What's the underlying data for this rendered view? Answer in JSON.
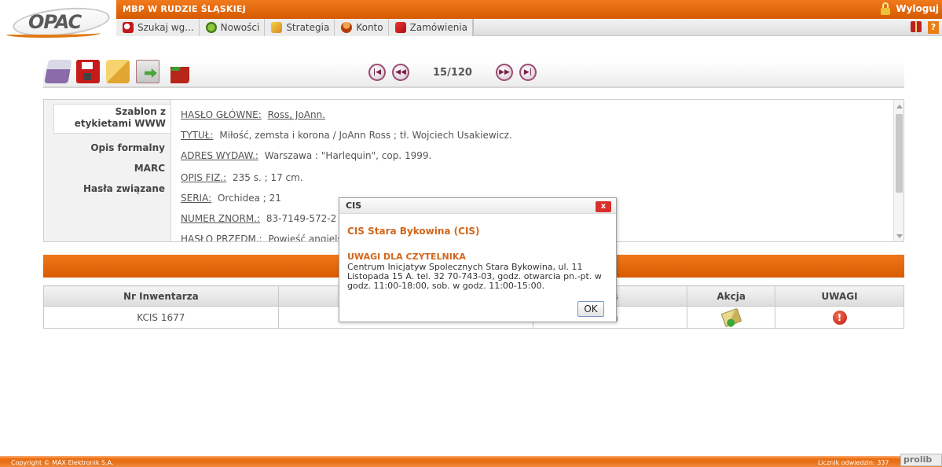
{
  "header": {
    "logo_text": "OPAC",
    "library_name": "MBP W RUDZIE ŚLĄSKIEJ",
    "logout_label": "Wyloguj"
  },
  "menu": {
    "items": [
      {
        "label": "Szukaj wg...",
        "icon": "search-icon"
      },
      {
        "label": "Nowości",
        "icon": "new-items-icon"
      },
      {
        "label": "Strategia",
        "icon": "strategy-icon"
      },
      {
        "label": "Konto",
        "icon": "account-icon"
      },
      {
        "label": "Zamówienia",
        "icon": "orders-icon"
      }
    ],
    "help_label": "?"
  },
  "pager": {
    "counter": "15/120"
  },
  "record": {
    "tabs": [
      {
        "label": "Szablon z etykietami WWW"
      },
      {
        "label": "Opis formalny"
      },
      {
        "label": "MARC"
      },
      {
        "label": "Hasła związane"
      }
    ],
    "fields": [
      {
        "label": "HASŁO GŁÓWNE:",
        "value": "Ross, JoAnn."
      },
      {
        "label": "TYTUŁ:",
        "value": "Miłość, zemsta i korona / JoAnn Ross ; tł. Wojciech Usakiewicz."
      },
      {
        "label": "ADRES WYDAW.:",
        "value": "Warszawa : \"Harlequin\", cop. 1999."
      },
      {
        "label": "OPIS FIZ.:",
        "value": "235 s. ; 17 cm."
      },
      {
        "label": "SERIA:",
        "value": "Orchidea ; 21"
      },
      {
        "label": "NUMER ZNORM.:",
        "value": "83-7149-572-2"
      },
      {
        "label": "HASŁO PRZEDM.:",
        "value": "Powieść angielska 2"
      }
    ]
  },
  "holdings": {
    "headers": [
      "Nr Inwentarza",
      "",
      "s",
      "Akcja",
      "UWAGI"
    ],
    "rows": [
      {
        "inventory": "KCIS 1677",
        "col2": "",
        "col3": "a"
      }
    ]
  },
  "dialog": {
    "title": "CIS",
    "close_label": "x",
    "heading": "CIS Stara Bykowina (CIS)",
    "subheading": "UWAGI DLA CZYTELNIKA",
    "text": "Centrum Inicjatyw Spolecznych Stara Bykowina, ul. 11 Listopada 15 A. tel. 32 70-743-03, godz. otwarcia pn.-pt. w godz. 11:00-18:00, sob. w godz. 11:00-15:00.",
    "ok_label": "OK"
  },
  "footer": {
    "copyright": "Copyright © MAX Elektronik S.A.",
    "counter": "Licznik odwiedzin: 337",
    "prolib": "prolib"
  },
  "colors": {
    "accent": "#e3650a",
    "dialog_heading": "#d2661a"
  }
}
